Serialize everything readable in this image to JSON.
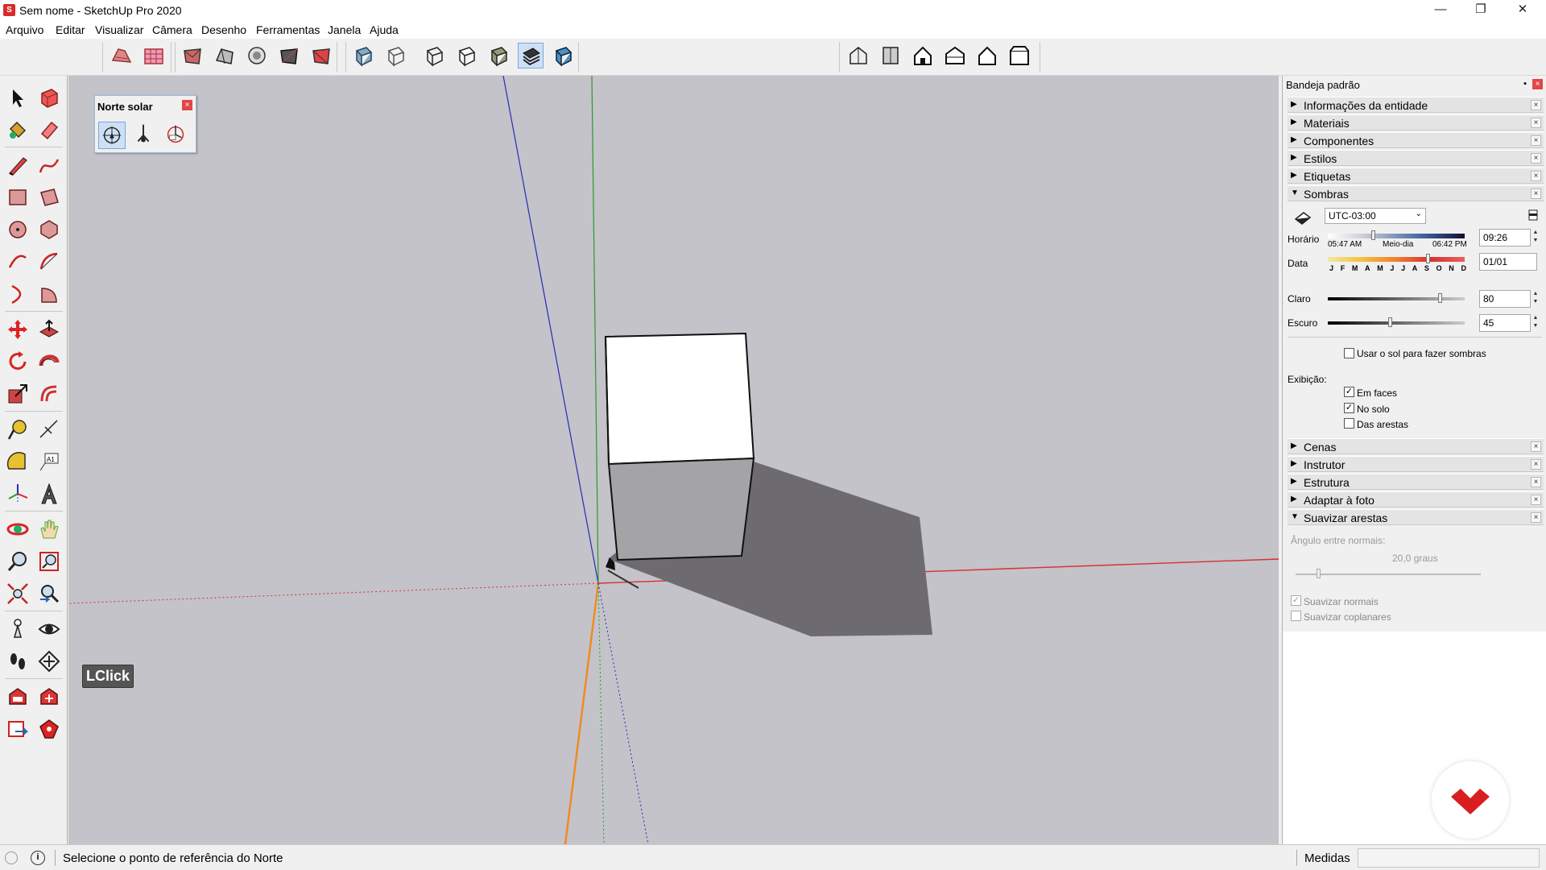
{
  "window": {
    "title": "Sem nome - SketchUp Pro 2020",
    "minimize": "—",
    "maximize": "❐",
    "close": "✕"
  },
  "menu": [
    "Arquivo",
    "Editar",
    "Visualizar",
    "Câmera",
    "Desenho",
    "Ferramentas",
    "Janela",
    "Ajuda"
  ],
  "norte_solar": {
    "title": "Norte solar",
    "close": "×"
  },
  "overlay": {
    "lclick": "LClick"
  },
  "tray": {
    "title": "Bandeja padrão",
    "panels_top": [
      "Informações da entidade",
      "Materiais",
      "Componentes",
      "Estilos",
      "Etiquetas",
      "Sombras"
    ],
    "panels_bottom": [
      "Cenas",
      "Instrutor",
      "Estrutura",
      "Adaptar à foto",
      "Suavizar arestas"
    ],
    "shadows": {
      "timezone": "UTC-03:00",
      "horario_label": "Horário",
      "sunrise": "05:47 AM",
      "noon": "Meio-dia",
      "sunset": "06:42 PM",
      "time_value": "09:26",
      "data_label": "Data",
      "months": [
        "J",
        "F",
        "M",
        "A",
        "M",
        "J",
        "J",
        "A",
        "S",
        "O",
        "N",
        "D"
      ],
      "date_value": "01/01",
      "claro_label": "Claro",
      "claro_value": "80",
      "escuro_label": "Escuro",
      "escuro_value": "45",
      "use_sun_label": "Usar o sol para fazer sombras",
      "use_sun_checked": false,
      "exibicao_label": "Exibição:",
      "em_faces_label": "Em faces",
      "em_faces_checked": true,
      "no_solo_label": "No solo",
      "no_solo_checked": true,
      "das_arestas_label": "Das arestas",
      "das_arestas_checked": false
    },
    "suavizar": {
      "angulo_label": "Ângulo entre normais:",
      "angulo_value": "20,0  graus",
      "suavizar_normais_label": "Suavizar normais",
      "suavizar_normais_checked": true,
      "suavizar_coplanares_label": "Suavizar coplanares",
      "suavizar_coplanares_checked": false
    }
  },
  "status": {
    "message": "Selecione o ponto de referência do Norte",
    "medidas_label": "Medidas"
  },
  "colors": {
    "axis_red": "#d83030",
    "axis_green": "#2a9a2a",
    "axis_blue": "#2a2ab8",
    "axis_orange": "#f08a20",
    "sky": "#c3c3c9",
    "shadow": "#6d6b70",
    "brand": "#d81e1e"
  }
}
